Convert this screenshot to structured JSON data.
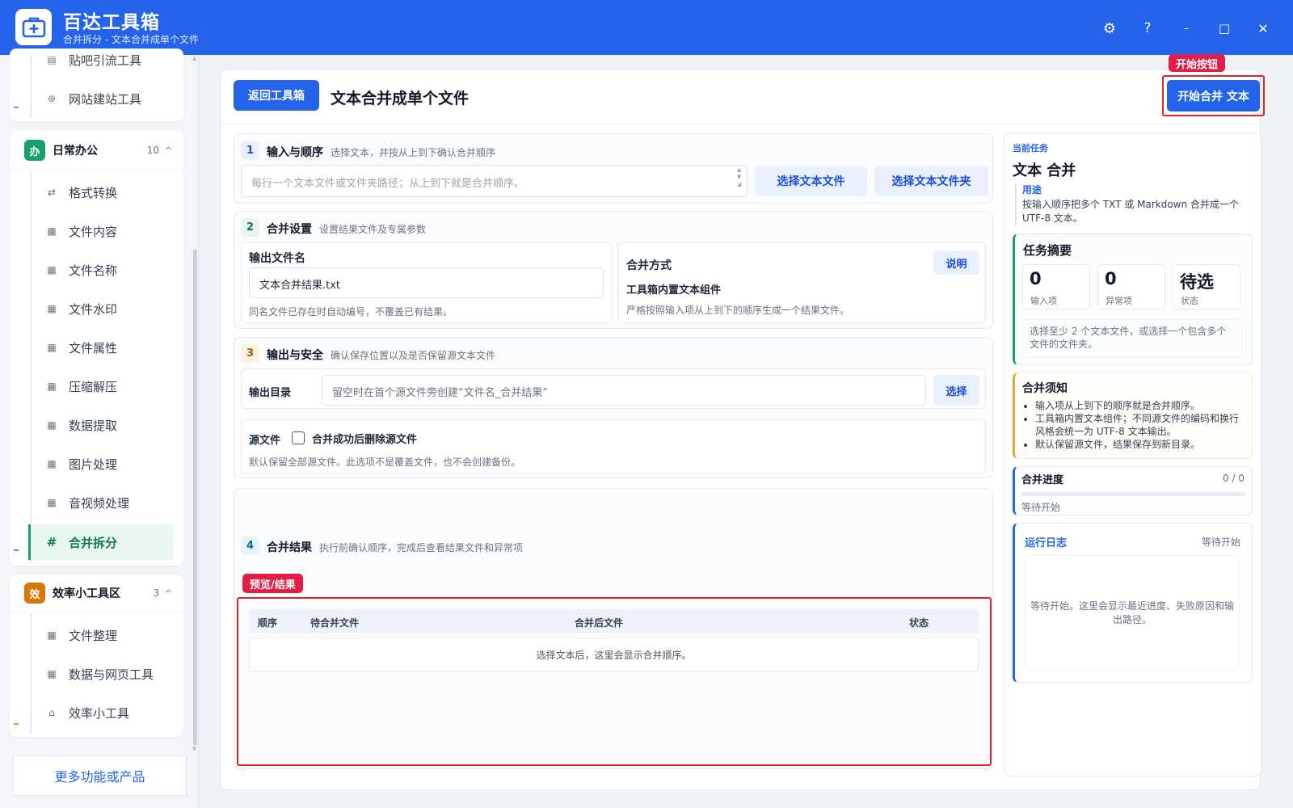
{
  "app": {
    "title": "百达工具箱",
    "subtitle": "合并拆分 - 文本合并成单个文件"
  },
  "window_controls": {
    "settings": "⚙",
    "help": "?",
    "minimize": "–",
    "maximize": "□",
    "close": "✕"
  },
  "sidebar": {
    "top_items": [
      {
        "label": "贴吧引流工具",
        "icon": "doc-icon"
      },
      {
        "label": "网站建站工具",
        "icon": "globe-icon"
      }
    ],
    "group_office": {
      "badge": "办",
      "name": "日常办公",
      "count": "10",
      "caret": "^",
      "items": [
        {
          "label": "格式转换",
          "icon": "swap-icon"
        },
        {
          "label": "文件内容",
          "icon": "grid-icon"
        },
        {
          "label": "文件名称",
          "icon": "grid-icon"
        },
        {
          "label": "文件水印",
          "icon": "grid-icon"
        },
        {
          "label": "文件属性",
          "icon": "grid-icon"
        },
        {
          "label": "压缩解压",
          "icon": "grid-icon"
        },
        {
          "label": "数据提取",
          "icon": "grid-icon"
        },
        {
          "label": "图片处理",
          "icon": "grid-icon"
        },
        {
          "label": "音视频处理",
          "icon": "grid-icon"
        },
        {
          "label": "合并拆分",
          "icon": "hash-icon"
        }
      ]
    },
    "group_efficiency": {
      "badge": "效",
      "name": "效率小工具区",
      "count": "3",
      "caret": "^",
      "items": [
        {
          "label": "文件整理",
          "icon": "grid-icon"
        },
        {
          "label": "数据与网页工具",
          "icon": "grid-icon"
        },
        {
          "label": "效率小工具",
          "icon": "box-icon"
        }
      ]
    },
    "more": "更多功能或产品"
  },
  "header": {
    "back": "返回工具箱",
    "title": "文本合并成单个文件",
    "start_tag": "开始按钮",
    "start": "开始合并 文本"
  },
  "sections": {
    "input": {
      "num": "1",
      "title": "输入与顺序",
      "desc": "选择文本，并按从上到下确认合并顺序",
      "placeholder": "每行一个文本文件或文件夹路径；从上到下就是合并顺序。",
      "btn_file": "选择文本文件",
      "btn_folder": "选择文本文件夹"
    },
    "settings": {
      "num": "2",
      "title": "合并设置",
      "desc": "设置结果文件及专属参数",
      "filename_label": "输出文件名",
      "filename_value": "文本合并结果.txt",
      "filename_hint": "同名文件已存在时自动编号，不覆盖已有结果。",
      "mode_label": "合并方式",
      "mode_help": "说明",
      "mode_value": "工具箱内置文本组件",
      "mode_hint": "严格按照输入项从上到下的顺序生成一个结果文件。"
    },
    "output": {
      "num": "3",
      "title": "输出与安全",
      "desc": "确认保存位置以及是否保留源文本文件",
      "dir_label": "输出目录",
      "dir_placeholder": "留空时在首个源文件旁创建“文件名_合并结果”",
      "dir_btn": "选择",
      "src_label": "源文件",
      "src_checkbox": "合并成功后删除源文件",
      "src_hint": "默认保留全部源文件。此选项不是覆盖文件，也不会创建备份。"
    },
    "result": {
      "num": "4",
      "title": "合并结果",
      "desc": "执行前确认顺序，完成后查看结果文件和异常项",
      "preview_tag": "预览/结果",
      "columns": [
        "顺序",
        "待合并文件",
        "合并后文件",
        "状态"
      ],
      "empty": "选择文本后，这里会显示合并顺序。"
    }
  },
  "right": {
    "task_label": "当前任务",
    "task_name": "文本 合并",
    "purpose_label": "用途",
    "purpose_text": "按输入顺序把多个 TXT 或 Markdown 合并成一个 UTF-8 文本。",
    "summary_title": "任务摘要",
    "stats": [
      {
        "value": "0",
        "key": "输入项"
      },
      {
        "value": "0",
        "key": "异常项"
      },
      {
        "value": "待选",
        "key": "状态"
      }
    ],
    "summary_hint": "选择至少 2 个文本文件，或选择一个包含多个文件的文件夹。",
    "notes_title": "合并须知",
    "notes": [
      "输入项从上到下的顺序就是合并顺序。",
      "工具箱内置文本组件；不同源文件的编码和换行风格会统一为 UTF-8 文本输出。",
      "默认保留源文件，结果保存到新目录。"
    ],
    "progress_title": "合并进度",
    "progress_count": "0 / 0",
    "progress_fraction": 0,
    "progress_status": "等待开始",
    "log_title": "运行日志",
    "log_status": "等待开始",
    "log_text": "等待开始。这里会显示最近进度、失败原因和输出路径。"
  },
  "colors": {
    "brand": "#2563eb",
    "highlight": "#dc2626",
    "office_badge": "#16a06a",
    "efficiency_badge": "#d97706"
  }
}
